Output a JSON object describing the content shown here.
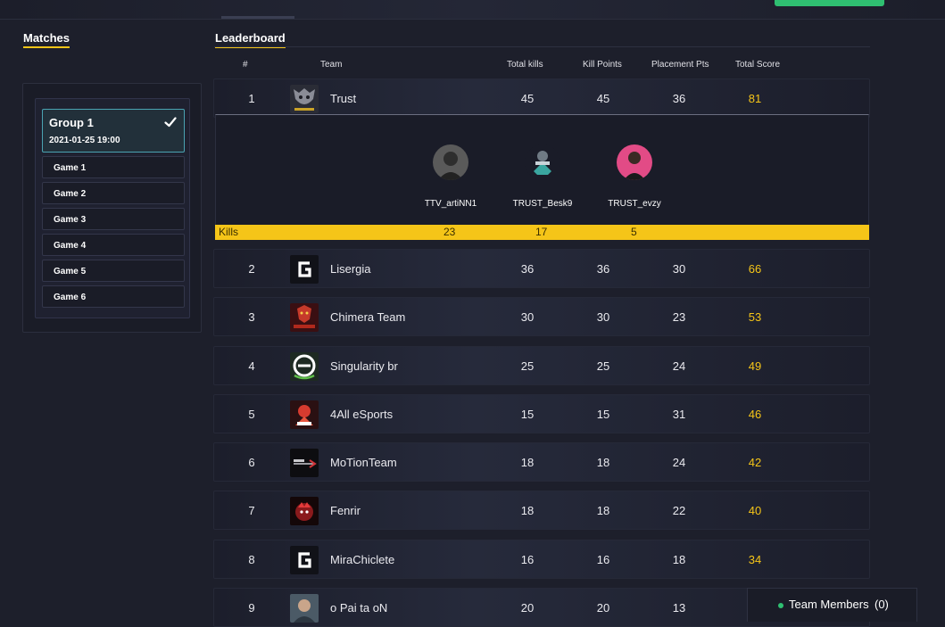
{
  "sections": {
    "matches": "Matches",
    "leaderboard": "Leaderboard"
  },
  "matches": {
    "group": {
      "name": "Group 1",
      "date": "2021-01-25 19:00",
      "selected": true
    },
    "games": [
      "Game 1",
      "Game 2",
      "Game 3",
      "Game 4",
      "Game 5",
      "Game 6"
    ]
  },
  "columns": {
    "rank": "#",
    "team": "Team",
    "total_kills": "Total kills",
    "kill_points": "Kill Points",
    "placement_pts": "Placement Pts",
    "total_score": "Total Score"
  },
  "rows": [
    {
      "rank": "1",
      "team": "Trust",
      "total_kills": "45",
      "kill_points": "45",
      "placement_pts": "36",
      "total_score": "81",
      "logo": "trust-logo"
    },
    {
      "rank": "2",
      "team": "Lisergia",
      "total_kills": "36",
      "kill_points": "36",
      "placement_pts": "30",
      "total_score": "66",
      "logo": "g-logo"
    },
    {
      "rank": "3",
      "team": "Chimera Team",
      "total_kills": "30",
      "kill_points": "30",
      "placement_pts": "23",
      "total_score": "53",
      "logo": "chimera-logo"
    },
    {
      "rank": "4",
      "team": "Singularity br",
      "total_kills": "25",
      "kill_points": "25",
      "placement_pts": "24",
      "total_score": "49",
      "logo": "singularity-logo"
    },
    {
      "rank": "5",
      "team": "4All eSports",
      "total_kills": "15",
      "kill_points": "15",
      "placement_pts": "31",
      "total_score": "46",
      "logo": "4all-logo"
    },
    {
      "rank": "6",
      "team": "MoTionTeam",
      "total_kills": "18",
      "kill_points": "18",
      "placement_pts": "24",
      "total_score": "42",
      "logo": "motion-logo"
    },
    {
      "rank": "7",
      "team": "Fenrir",
      "total_kills": "18",
      "kill_points": "18",
      "placement_pts": "22",
      "total_score": "40",
      "logo": "fenrir-logo"
    },
    {
      "rank": "8",
      "team": "MiraChiclete",
      "total_kills": "16",
      "kill_points": "16",
      "placement_pts": "18",
      "total_score": "34",
      "logo": "g-logo"
    },
    {
      "rank": "9",
      "team": "o Pai ta oN",
      "total_kills": "20",
      "kill_points": "20",
      "placement_pts": "13",
      "total_score": "",
      "logo": "paitaon-logo"
    }
  ],
  "expanded": {
    "players": [
      {
        "name": "TTV_artiNN1",
        "kills": "23"
      },
      {
        "name": "TRUST_Besk9",
        "kills": "17"
      },
      {
        "name": "TRUST_evzy",
        "kills": "5"
      }
    ],
    "kills_label": "Kills"
  },
  "team_members": {
    "label": "Team Members",
    "count": "(0)"
  },
  "colors": {
    "accent": "#f5c518",
    "selected_border": "#4aa3b2",
    "online": "#2fbf71"
  }
}
